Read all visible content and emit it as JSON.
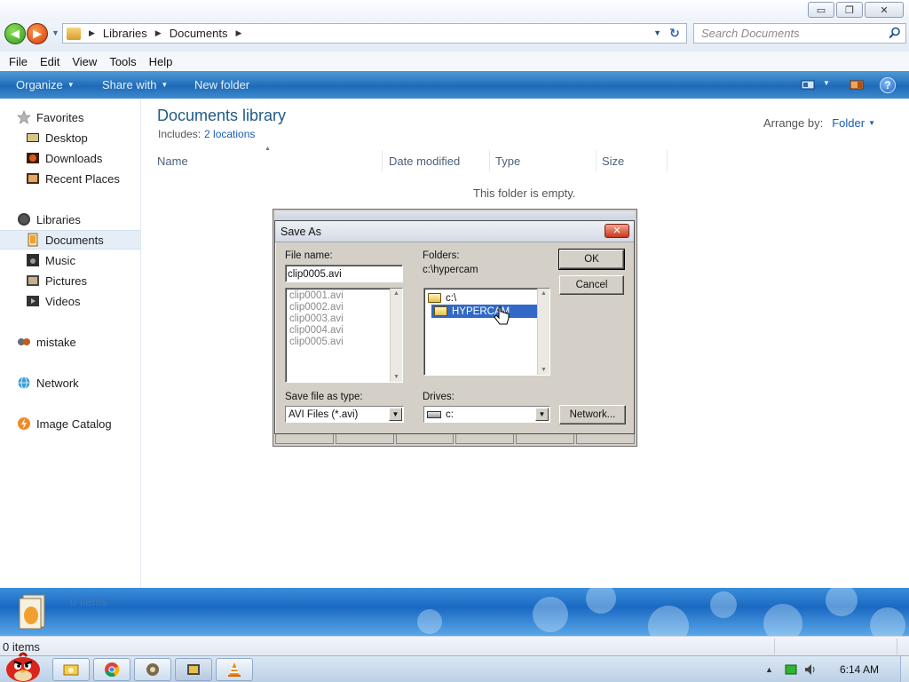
{
  "window": {
    "minimize_glyph": "▭",
    "maximize_glyph": "❐",
    "close_glyph": "✕"
  },
  "address": {
    "crumbs": [
      "Libraries",
      "Documents"
    ],
    "search_placeholder": "Search Documents"
  },
  "menu": [
    "File",
    "Edit",
    "View",
    "Tools",
    "Help"
  ],
  "commands": {
    "organize": "Organize",
    "share_with": "Share with",
    "new_folder": "New folder",
    "help": "?"
  },
  "nav": {
    "favorites": "Favorites",
    "desktop": "Desktop",
    "downloads": "Downloads",
    "recent_places": "Recent Places",
    "libraries": "Libraries",
    "documents": "Documents",
    "music": "Music",
    "pictures": "Pictures",
    "videos": "Videos",
    "mistake": "mistake",
    "network": "Network",
    "image_catalog": "Image Catalog"
  },
  "content": {
    "title": "Documents library",
    "includes_label": "Includes:",
    "includes_link": "2 locations",
    "arrange_label": "Arrange by:",
    "arrange_value": "Folder",
    "columns": [
      "Name",
      "Date modified",
      "Type",
      "Size"
    ],
    "empty_message": "This folder is empty."
  },
  "details": {
    "count": "0 items"
  },
  "status": {
    "text": "0 items"
  },
  "taskbar": {
    "clock": "6:14 AM"
  },
  "dialog": {
    "title": "Save As",
    "close_glyph": "✕",
    "file_name_label": "File name:",
    "file_name_value": "clip0005.avi",
    "files": [
      "clip0001.avi",
      "clip0002.avi",
      "clip0003.avi",
      "clip0004.avi",
      "clip0005.avi"
    ],
    "folders_label": "Folders:",
    "current_path": "c:\\hypercam",
    "folder_tree": [
      "c:\\",
      "HYPERCAM"
    ],
    "save_type_label": "Save file as type:",
    "save_type_value": "AVI Files (*.avi)",
    "drives_label": "Drives:",
    "drive_value": "c:",
    "ok": "OK",
    "cancel": "Cancel",
    "network": "Network..."
  },
  "colors": {
    "command_bar": "#1f6ab6",
    "selection": "#3169c6",
    "link": "#1a5db5",
    "dialog_face": "#d4d0c8"
  }
}
